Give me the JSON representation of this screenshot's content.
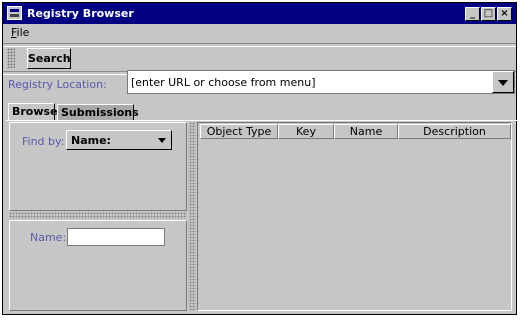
{
  "window": {
    "title": "Registry Browser"
  },
  "title_buttons": {
    "minimize": "_",
    "maximize": "□",
    "close": "×"
  },
  "menu": {
    "file_label": "File",
    "file_mnemonic": "F",
    "file_rest": "ile"
  },
  "toolbar": {
    "search_label": "Search"
  },
  "registry": {
    "label": "Registry Location:",
    "value": "[enter URL or choose from menu]"
  },
  "tabs": [
    {
      "label": "Browse",
      "selected": true
    },
    {
      "label": "Submissions",
      "selected": false
    }
  ],
  "find_by": {
    "label": "Find by:",
    "selected": "Name:"
  },
  "name_field": {
    "label": "Name:",
    "value": ""
  },
  "table": {
    "columns": [
      "Object Type",
      "Key",
      "Name",
      "Description"
    ],
    "rows": []
  }
}
